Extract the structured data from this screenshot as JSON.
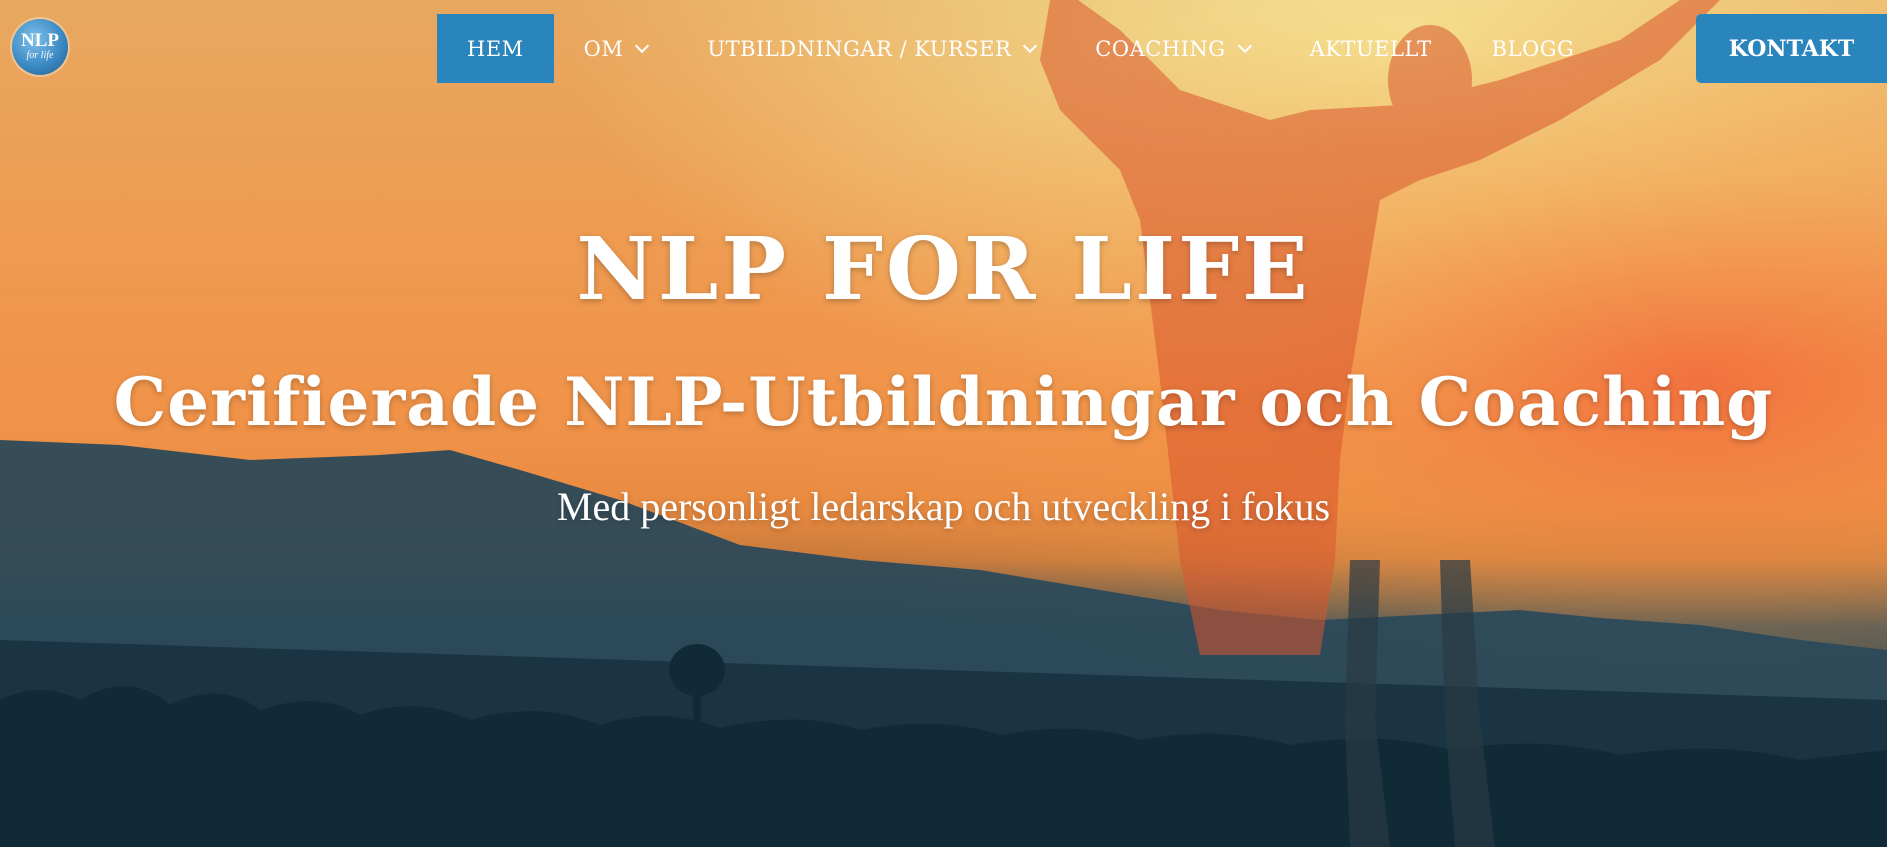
{
  "logo": {
    "main": "NLP",
    "sub": "for life"
  },
  "nav": {
    "items": [
      {
        "label": "HEM",
        "active": true,
        "dropdown": false
      },
      {
        "label": "OM",
        "active": false,
        "dropdown": true
      },
      {
        "label": "UTBILDNINGAR / KURSER",
        "active": false,
        "dropdown": true
      },
      {
        "label": "COACHING",
        "active": false,
        "dropdown": true
      },
      {
        "label": "AKTUELLT",
        "active": false,
        "dropdown": false
      },
      {
        "label": "BLOGG",
        "active": false,
        "dropdown": false
      }
    ],
    "cta": "KONTAKT"
  },
  "hero": {
    "title": "NLP FOR LIFE",
    "subtitle": "Cerifierade NLP-Utbildningar och Coaching",
    "tagline": "Med personligt ledarskap och utveckling i fokus"
  },
  "colors": {
    "accent": "#2a85bc",
    "text": "#ffffff"
  }
}
